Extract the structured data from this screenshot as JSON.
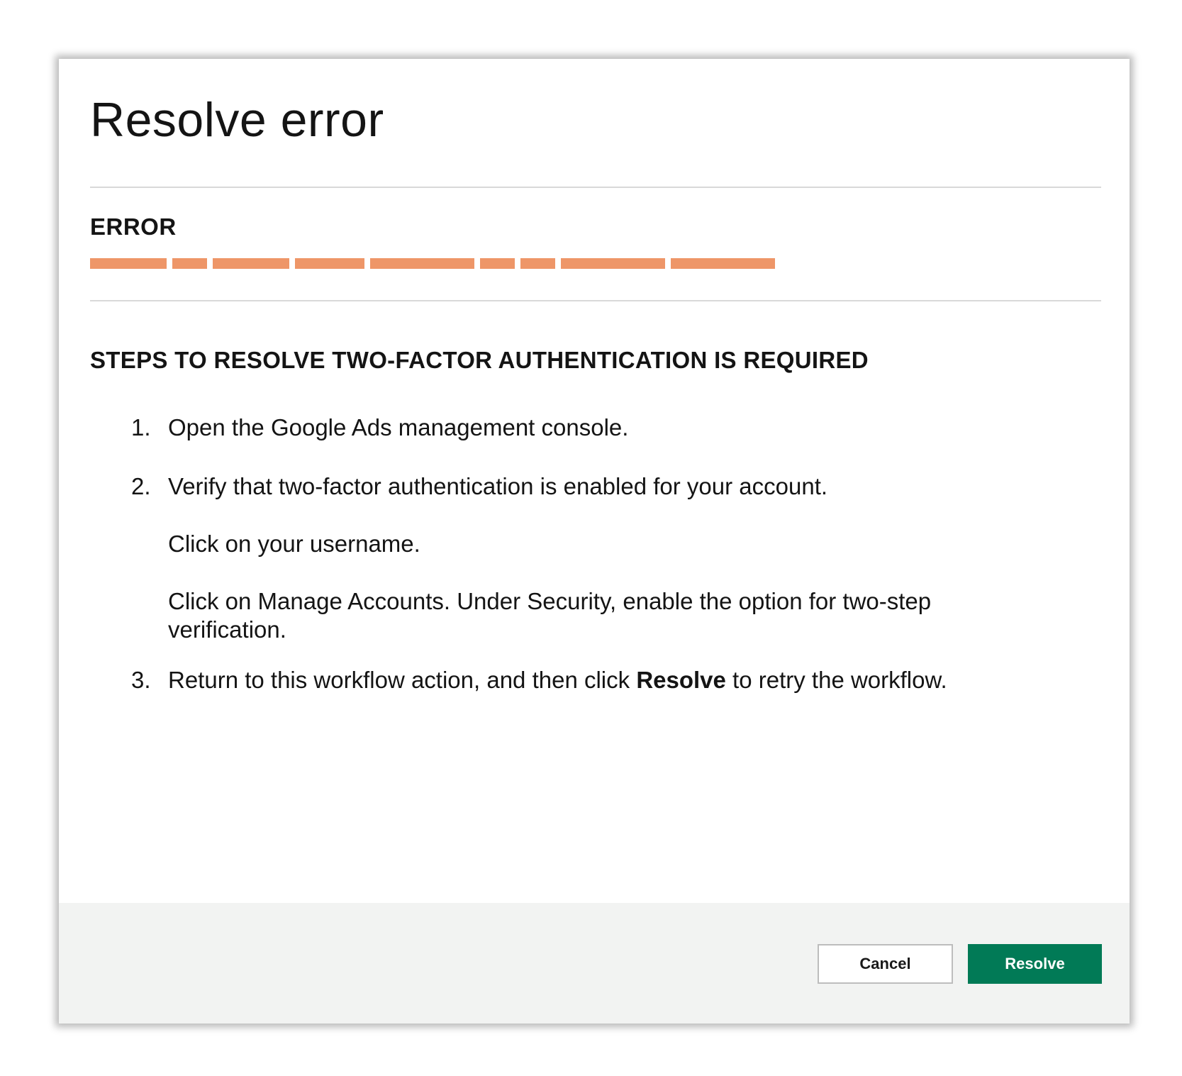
{
  "dialog": {
    "title": "Resolve error",
    "error_label": "ERROR",
    "redaction_color": "#ee9668",
    "steps_heading": "STEPS TO RESOLVE TWO-FACTOR AUTHENTICATION IS REQUIRED",
    "steps": [
      {
        "num": "1.",
        "text": "Open the Google Ads management console."
      },
      {
        "num": "2.",
        "text": "Verify that two-factor authentication is enabled for your account.",
        "sub_1": "Click on your username.",
        "sub_2": "Click on Manage Accounts. Under Security, enable the option for two-step verification."
      },
      {
        "num": "3.",
        "text_before": "Return to this workflow action, and then click ",
        "text_bold": "Resolve",
        "text_after": " to retry the workflow."
      }
    ]
  },
  "footer": {
    "cancel_label": "Cancel",
    "resolve_label": "Resolve",
    "resolve_color": "#017a56"
  }
}
